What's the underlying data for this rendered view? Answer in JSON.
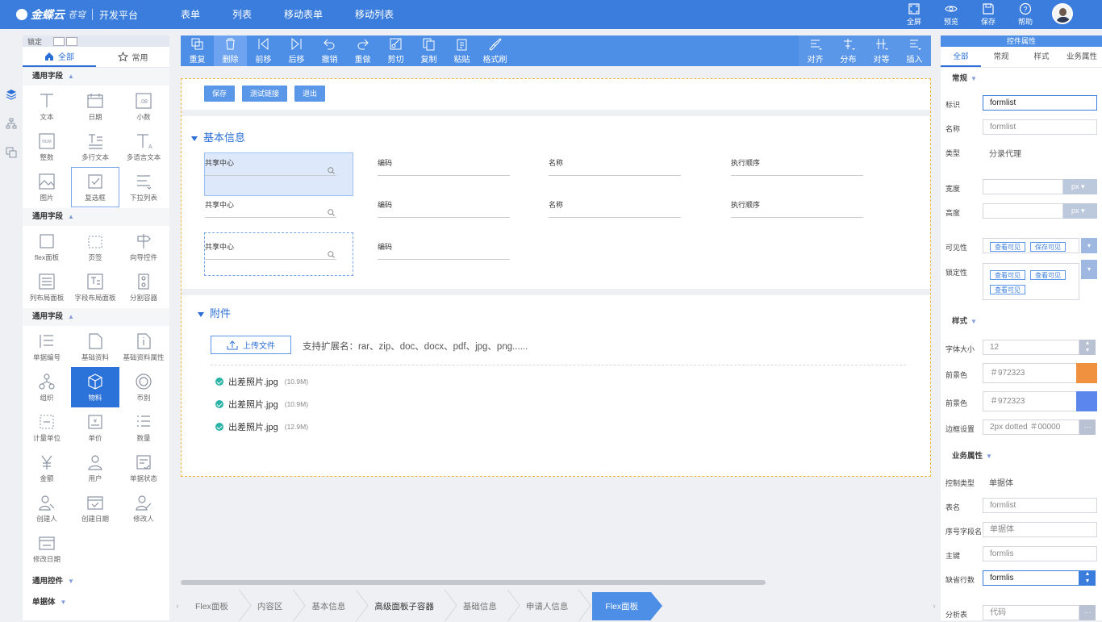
{
  "app": {
    "logo_text": "金蝶云",
    "logo_sub": "苍穹",
    "platform": "开发平台"
  },
  "topnav": [
    "表单",
    "列表",
    "移动表单",
    "移动列表"
  ],
  "top_actions": [
    {
      "label": "全屏",
      "icon": "fullscreen-icon"
    },
    {
      "label": "预览",
      "icon": "eye-icon"
    },
    {
      "label": "保存",
      "icon": "save-icon"
    },
    {
      "label": "帮助",
      "icon": "help-icon"
    }
  ],
  "left_panel": {
    "lock_label": "锁定",
    "tabs": [
      {
        "label": "全部",
        "icon": "home-icon",
        "active": true
      },
      {
        "label": "常用",
        "icon": "star-icon",
        "active": false
      }
    ],
    "sections": [
      {
        "title": "通用字段",
        "items": [
          "文本",
          "日期",
          "小数",
          "整数",
          "多行文本",
          "多语言文本",
          "图片",
          "复选框",
          "下拉列表"
        ]
      },
      {
        "title": "通用字段",
        "items": [
          "flex面板",
          "页签",
          "向导控件",
          "列布局面板",
          "字段布局面板",
          "分割容器"
        ]
      },
      {
        "title": "通用字段",
        "items": [
          "单据编号",
          "基础资料",
          "基础资料属性",
          "组织",
          "物料",
          "币别",
          "计量单位",
          "单价",
          "数量",
          "金额",
          "用户",
          "单据状态",
          "创建人",
          "创建日期",
          "修改人",
          "修改日期"
        ]
      }
    ],
    "collapsed_sections": [
      "通用控件",
      "单据体"
    ],
    "selected_item": "物料",
    "hover_item": "复选框"
  },
  "toolbar": {
    "items": [
      "重复",
      "删除",
      "前移",
      "后移",
      "撤销",
      "重做",
      "剪切",
      "复制",
      "粘贴",
      "格式刷"
    ],
    "active": "删除",
    "right_items": [
      "对齐",
      "分布",
      "对等",
      "插入"
    ]
  },
  "canvas": {
    "buttons": [
      "保存",
      "测试链接",
      "退出"
    ],
    "section1_title": "基本信息",
    "rows": [
      [
        "共享中心",
        "编码",
        "名称",
        "执行顺序"
      ],
      [
        "共享中心",
        "编码",
        "名称",
        "执行顺序"
      ],
      [
        "共享中心",
        "编码"
      ]
    ],
    "section2_title": "附件",
    "upload_label": "上传文件",
    "upload_hint": "支持扩展名：rar、zip、doc、docx、pdf、jpg、png......",
    "files": [
      {
        "name": "出差照片.jpg",
        "size": "(10.9M)"
      },
      {
        "name": "出差照片.jpg",
        "size": "(10.9M)"
      },
      {
        "name": "出差照片.jpg",
        "size": "(12.9M)"
      }
    ]
  },
  "breadcrumb": [
    "Flex面板",
    "内容区",
    "基本信息",
    "高级面板子容器",
    "基础信息",
    "申请人信息",
    "Flex面板"
  ],
  "right_panel": {
    "title": "控件属性",
    "tabs": [
      "全部",
      "常规",
      "样式",
      "业务属性"
    ],
    "general_title": "常规",
    "id_label": "标识",
    "id_value": "formlist",
    "name_label": "名称",
    "name_value": "formlist",
    "type_label": "类型",
    "type_value": "分录代理",
    "width_label": "宽度",
    "height_label": "高度",
    "unit": "px",
    "visibility_label": "可见性",
    "visibility_tags": [
      "查看可见",
      "保存可见"
    ],
    "lock_label": "锁定性",
    "lock_tags": [
      "查看可见",
      "查看可见",
      "查看可见"
    ],
    "style_title": "样式",
    "font_size_label": "字体大小",
    "font_size_value": "12",
    "fg_label": "前景色",
    "fg_value": "＃972323",
    "fg_color": "#f0913f",
    "bg_label": "前景色",
    "bg_value": "＃972323",
    "bg_color": "#5b87ec",
    "border_label": "边框设置",
    "border_value": "2px dotted ＃00000",
    "biz_title": "业务属性",
    "ctrl_type_label": "控制类型",
    "ctrl_type_value": "单据体",
    "table_label": "表名",
    "table_value": "formlist",
    "seq_label": "序号字段名",
    "seq_value": "单据体",
    "pk_label": "主键",
    "pk_value": "formlis",
    "default_rows_label": "缺省行数",
    "default_rows_value": "formlis",
    "analysis_label": "分析表",
    "analysis_value": "代码"
  }
}
